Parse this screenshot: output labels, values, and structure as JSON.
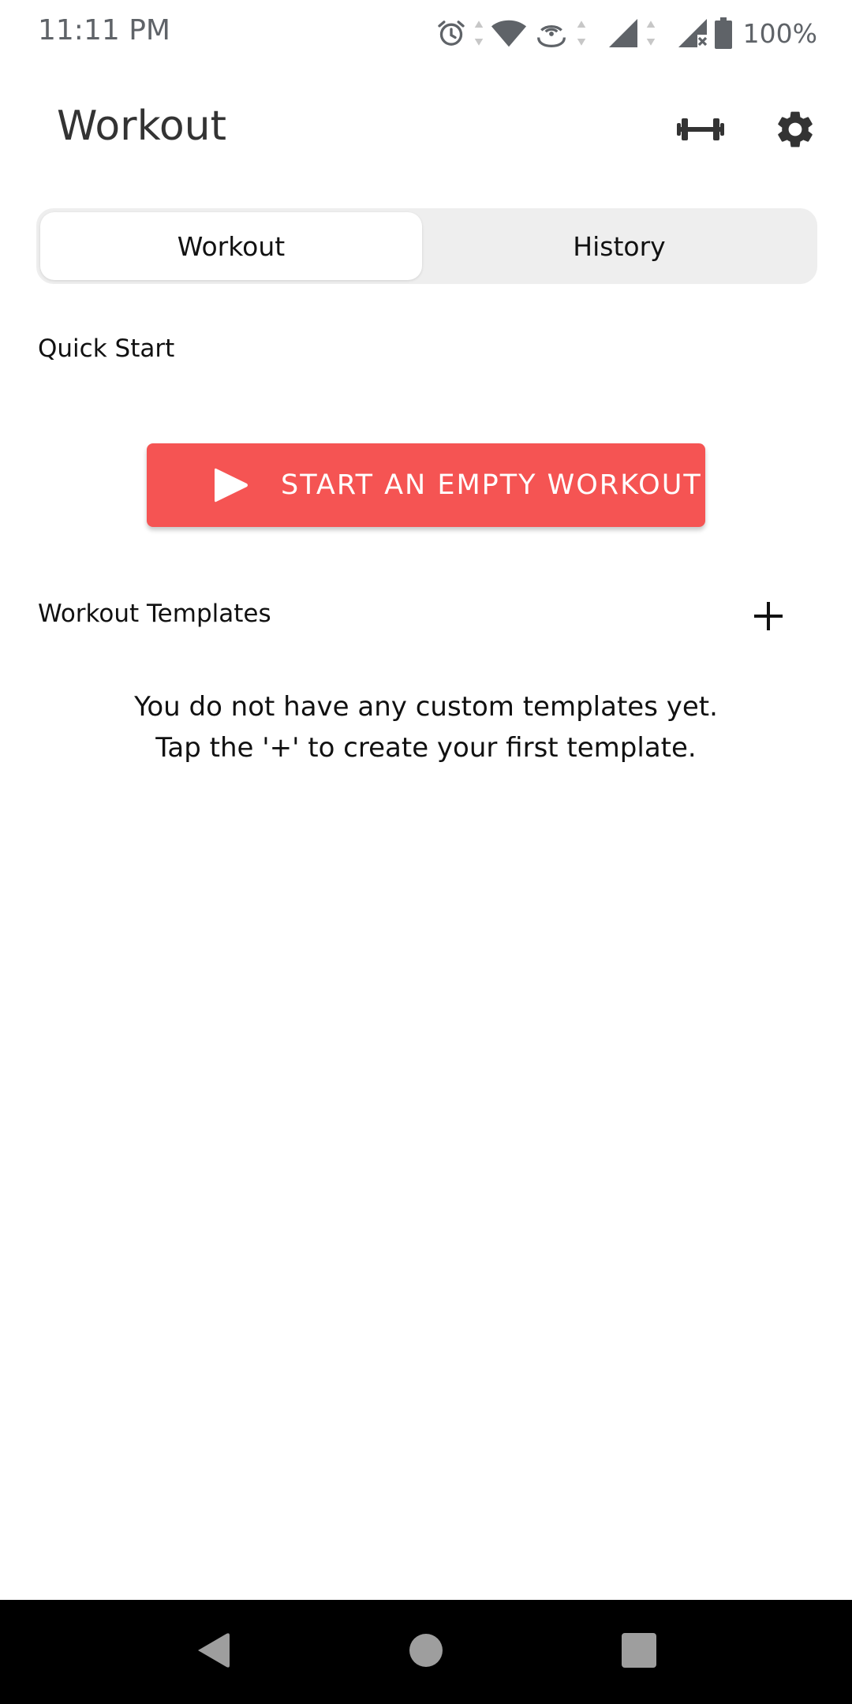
{
  "status_bar": {
    "time": "11:11 PM",
    "battery": "100%",
    "icons": [
      "alarm-icon",
      "wifi-icon",
      "hotspot-icon",
      "signal-icon",
      "signal-no-sim-icon",
      "battery-icon"
    ]
  },
  "app_bar": {
    "title": "Workout",
    "actions": [
      "dumbbell-icon",
      "settings-icon"
    ]
  },
  "tabs": [
    {
      "label": "Workout",
      "selected": true
    },
    {
      "label": "History",
      "selected": false
    }
  ],
  "quick_start": {
    "label": "Quick Start",
    "button_label": "START AN EMPTY WORKOUT",
    "button_icon": "play-icon",
    "button_color": "#f55453"
  },
  "templates": {
    "label": "Workout Templates",
    "add_icon": "plus-icon",
    "empty_line_1": "You do not have any custom templates yet.",
    "empty_line_2": "Tap the '+' to create your first template."
  },
  "nav_bar": {
    "buttons": [
      "back-icon",
      "home-icon",
      "recents-icon"
    ]
  }
}
